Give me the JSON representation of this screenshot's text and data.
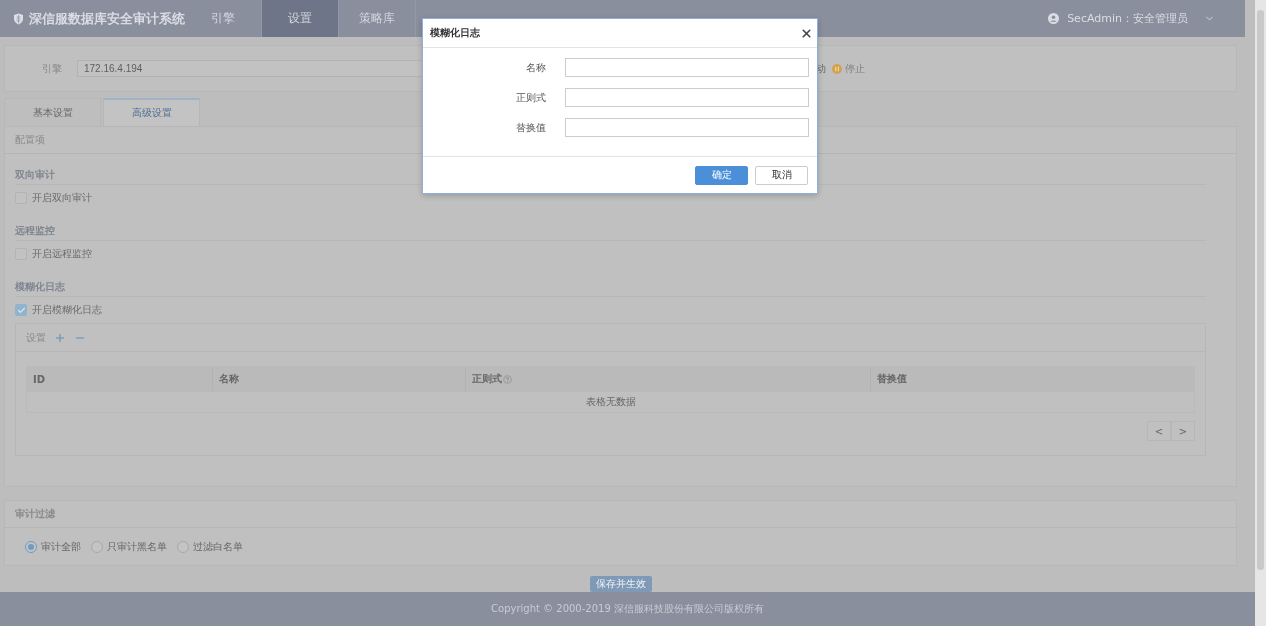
{
  "app": {
    "title": "深信服数据库安全审计系统"
  },
  "nav": [
    {
      "label": "引擎",
      "selected": false
    },
    {
      "label": "设置",
      "selected": true
    },
    {
      "label": "策略库",
      "selected": false
    }
  ],
  "user": {
    "label": "SecAdmin：安全管理员"
  },
  "engine": {
    "label": "引擎",
    "value": "172.16.4.194",
    "status_text": "动",
    "stop_label": "停止"
  },
  "tabs": [
    {
      "label": "基本设置",
      "selected": false
    },
    {
      "label": "高级设置",
      "selected": true
    }
  ],
  "config": {
    "title": "配置项",
    "sections": [
      {
        "title": "双向审计",
        "option": {
          "label": "开启双向审计",
          "checked": false
        }
      },
      {
        "title": "远程监控",
        "option": {
          "label": "开启远程监控",
          "checked": false
        }
      },
      {
        "title": "模糊化日志",
        "option": {
          "label": "开启模糊化日志",
          "checked": true
        }
      }
    ]
  },
  "fuzzy_settings": {
    "title": "设置",
    "columns": [
      {
        "label": "ID",
        "help": false
      },
      {
        "label": "名称",
        "help": false
      },
      {
        "label": "正则式",
        "help": true
      },
      {
        "label": "替换值",
        "help": false
      }
    ],
    "empty_text": "表格无数据",
    "pager": [
      "<",
      ">"
    ]
  },
  "audit_filter": {
    "title": "审计过滤",
    "options": [
      {
        "label": "审计全部",
        "selected": true
      },
      {
        "label": "只审计黑名单",
        "selected": false
      },
      {
        "label": "过滤白名单",
        "selected": false
      }
    ]
  },
  "save_button": "保存并生效",
  "footer": "Copyright © 2000-2019 深信服科技股份有限公司版权所有",
  "dialog": {
    "title": "模糊化日志",
    "fields": [
      {
        "label": "名称"
      },
      {
        "label": "正则式"
      },
      {
        "label": "替换值"
      }
    ],
    "buttons": [
      {
        "label": "确定",
        "kind": "primary"
      },
      {
        "label": "取消",
        "kind": "default"
      }
    ]
  }
}
